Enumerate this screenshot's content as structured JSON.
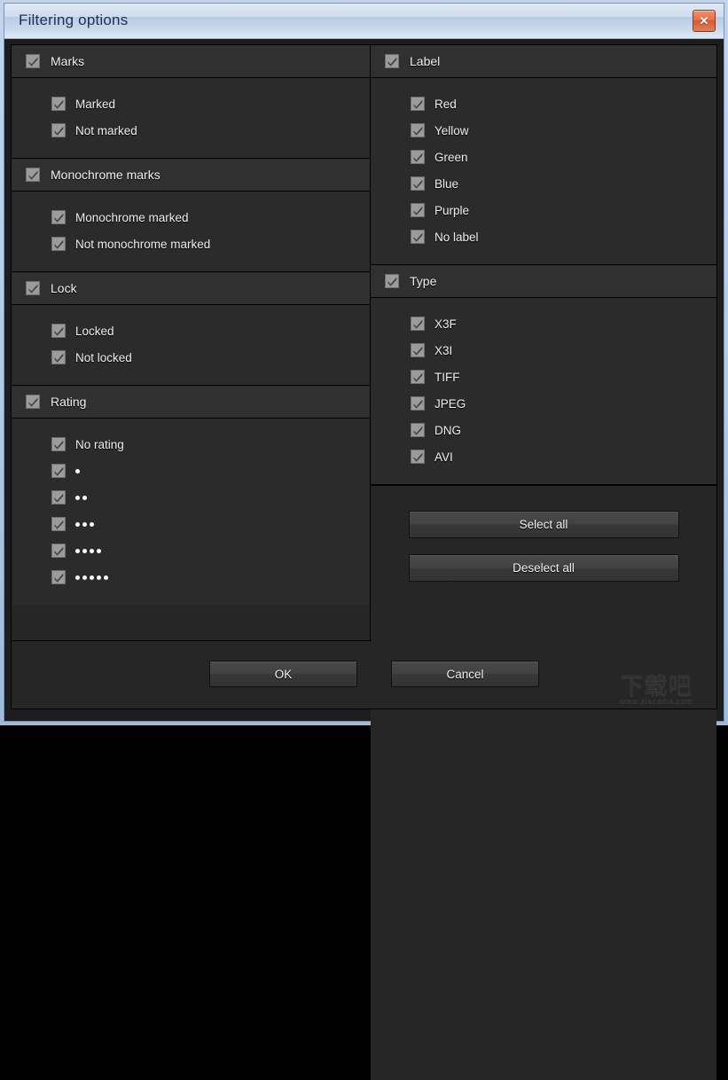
{
  "window": {
    "title": "Filtering options",
    "close_icon": "close-icon",
    "close_glyph": "✕"
  },
  "colors": {
    "titlebar_start": "#dfe8f4",
    "titlebar_end": "#dfeaf6",
    "title_text": "#203050",
    "dialog_background": "#1d1d1d",
    "panel_background": "#2b2b2b",
    "group_header_background": "#303030",
    "close_button": "#e8724a",
    "checkbox_fill": "#9b9b9b",
    "checkbox_mark": "#3b3b3b",
    "text": "#efefef"
  },
  "left_column": {
    "groups": [
      {
        "name": "marks",
        "header": {
          "label": "Marks",
          "checked": true
        },
        "items": [
          {
            "label": "Marked",
            "checked": true
          },
          {
            "label": "Not marked",
            "checked": true
          }
        ]
      },
      {
        "name": "monochrome-marks",
        "header": {
          "label": "Monochrome marks",
          "checked": true
        },
        "items": [
          {
            "label": "Monochrome marked",
            "checked": true
          },
          {
            "label": "Not monochrome marked",
            "checked": true
          }
        ]
      },
      {
        "name": "lock",
        "header": {
          "label": "Lock",
          "checked": true
        },
        "items": [
          {
            "label": "Locked",
            "checked": true
          },
          {
            "label": "Not locked",
            "checked": true
          }
        ]
      },
      {
        "name": "rating",
        "header": {
          "label": "Rating",
          "checked": true
        },
        "items": [
          {
            "label": "No rating",
            "checked": true,
            "dots": 0
          },
          {
            "label": "",
            "checked": true,
            "dots": 1
          },
          {
            "label": "",
            "checked": true,
            "dots": 2
          },
          {
            "label": "",
            "checked": true,
            "dots": 3
          },
          {
            "label": "",
            "checked": true,
            "dots": 4
          },
          {
            "label": "",
            "checked": true,
            "dots": 5
          }
        ]
      }
    ]
  },
  "right_column": {
    "groups": [
      {
        "name": "label",
        "header": {
          "label": "Label",
          "checked": true
        },
        "items": [
          {
            "label": "Red",
            "checked": true
          },
          {
            "label": "Yellow",
            "checked": true
          },
          {
            "label": "Green",
            "checked": true
          },
          {
            "label": "Blue",
            "checked": true
          },
          {
            "label": "Purple",
            "checked": true
          },
          {
            "label": "No label",
            "checked": true
          }
        ]
      },
      {
        "name": "type",
        "header": {
          "label": "Type",
          "checked": true
        },
        "items": [
          {
            "label": "X3F",
            "checked": true
          },
          {
            "label": "X3I",
            "checked": true
          },
          {
            "label": "TIFF",
            "checked": true
          },
          {
            "label": "JPEG",
            "checked": true
          },
          {
            "label": "DNG",
            "checked": true
          },
          {
            "label": "AVI",
            "checked": true
          }
        ]
      }
    ],
    "actions": {
      "select_all_label": "Select all",
      "deselect_all_label": "Deselect all"
    }
  },
  "footer": {
    "ok_label": "OK",
    "cancel_label": "Cancel"
  },
  "watermark": {
    "main": "下载吧",
    "sub": "www.xiazaiba.com"
  }
}
